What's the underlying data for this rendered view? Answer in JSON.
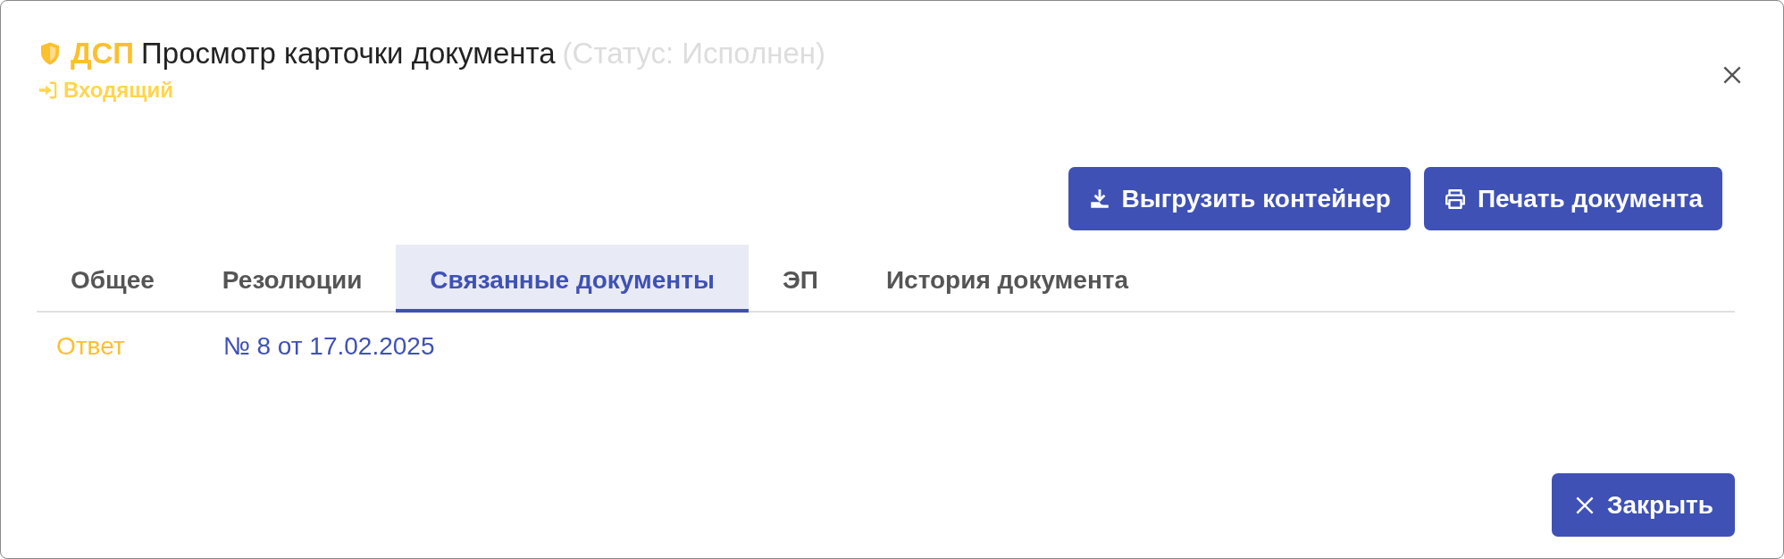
{
  "header": {
    "badge": "ДСП",
    "title": "Просмотр карточки документа",
    "status": "(Статус: Исполнен)",
    "direction": "Входящий"
  },
  "actions": [
    {
      "kind": "download",
      "label": "Выгрузить контейнер"
    },
    {
      "kind": "print",
      "label": "Печать документа"
    }
  ],
  "tabs": [
    {
      "label": "Общее",
      "selected": false
    },
    {
      "label": "Резолюции",
      "selected": false
    },
    {
      "label": "Связанные документы",
      "selected": true
    },
    {
      "label": "ЭП",
      "selected": false
    },
    {
      "label": "История документа",
      "selected": false
    }
  ],
  "links": [
    {
      "relation": "Ответ",
      "document": "№ 8 от 17.02.2025"
    }
  ],
  "footer": {
    "close": "Закрыть"
  }
}
